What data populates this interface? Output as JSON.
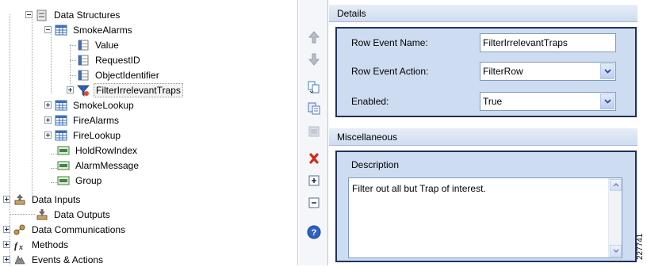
{
  "tree": {
    "items": [
      {
        "label": "Data Structures",
        "icon": "data-structures-icon",
        "expander": "minus"
      },
      {
        "label": "SmokeAlarms",
        "icon": "table-icon",
        "expander": "minus"
      },
      {
        "label": "Value",
        "icon": "column-icon",
        "expander": null
      },
      {
        "label": "RequestID",
        "icon": "column-icon",
        "expander": null
      },
      {
        "label": "ObjectIdentifier",
        "icon": "column-icon",
        "expander": null
      },
      {
        "label": "FilterIrrelevantTraps",
        "icon": "filter-icon",
        "expander": "plus",
        "selected": true
      },
      {
        "label": "SmokeLookup",
        "icon": "table-icon",
        "expander": "plus"
      },
      {
        "label": "FireAlarms",
        "icon": "table-icon",
        "expander": "plus"
      },
      {
        "label": "FireLookup",
        "icon": "table-icon",
        "expander": "plus"
      },
      {
        "label": "HoldRowIndex",
        "icon": "variable-icon",
        "expander": null
      },
      {
        "label": "AlarmMessage",
        "icon": "variable-icon",
        "expander": null
      },
      {
        "label": "Group",
        "icon": "variable-icon",
        "expander": null
      },
      {
        "label": "Data Inputs",
        "icon": "data-inputs-icon",
        "expander": "plus"
      },
      {
        "label": "Data Outputs",
        "icon": "data-outputs-icon",
        "expander": null
      },
      {
        "label": "Data Communications",
        "icon": "data-communications-icon",
        "expander": "plus"
      },
      {
        "label": "Methods",
        "icon": "methods-icon",
        "expander": "plus"
      },
      {
        "label": "Events & Actions",
        "icon": "events-actions-icon",
        "expander": "plus"
      }
    ]
  },
  "toolbar": {
    "buttons": [
      "move-up-icon",
      "move-down-icon",
      "copy-icon",
      "paste-icon",
      "disabled-icon",
      "delete-icon",
      "expand-icon",
      "collapse-icon",
      "help-icon"
    ]
  },
  "details": {
    "header": "Details",
    "row_event_name_label": "Row Event Name:",
    "row_event_name_value": "FilterIrrelevantTraps",
    "row_event_action_label": "Row Event Action:",
    "row_event_action_value": "FilterRow",
    "enabled_label": "Enabled:",
    "enabled_value": "True"
  },
  "misc": {
    "header": "Miscellaneous",
    "description_label": "Description",
    "description_value": "Filter out all but Trap of interest."
  },
  "figure_id": "227741",
  "colors": {
    "group_box_bg": "#cddcf1",
    "group_box_border": "#21315a",
    "delete_red": "#d42a1c",
    "table_blue": "#3d6fb8"
  }
}
